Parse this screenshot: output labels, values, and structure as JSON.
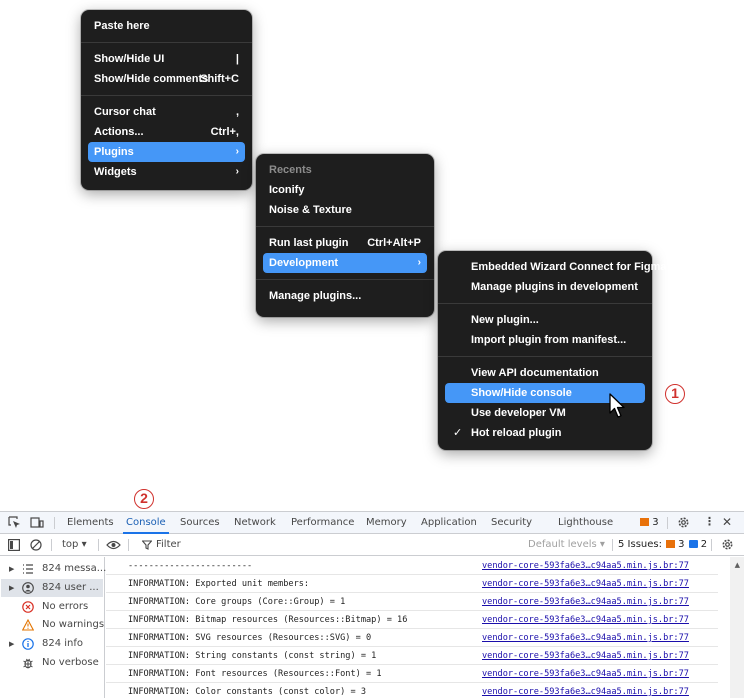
{
  "main_menu": {
    "items": [
      {
        "label": "Paste here",
        "shortcut": ""
      },
      {
        "label": "Show/Hide UI",
        "shortcut": "|"
      },
      {
        "label": "Show/Hide comments",
        "shortcut": "Shift+C"
      },
      {
        "label": "Cursor chat",
        "shortcut": ","
      },
      {
        "label": "Actions...",
        "shortcut": "Ctrl+,"
      },
      {
        "label": "Plugins",
        "chevron": "›"
      },
      {
        "label": "Widgets",
        "chevron": "›"
      }
    ]
  },
  "plugins_menu": {
    "header": "Recents",
    "items": [
      {
        "label": "Iconify"
      },
      {
        "label": "Noise & Texture"
      },
      {
        "label": "Run last plugin",
        "shortcut": "Ctrl+Alt+P"
      },
      {
        "label": "Development",
        "chevron": "›"
      },
      {
        "label": "Manage plugins..."
      }
    ]
  },
  "development_menu": {
    "items": [
      {
        "label": "Embedded Wizard Connect for Figma"
      },
      {
        "label": "Manage plugins in development"
      },
      {
        "label": "New plugin..."
      },
      {
        "label": "Import plugin from manifest..."
      },
      {
        "label": "View API documentation"
      },
      {
        "label": "Show/Hide console"
      },
      {
        "label": "Use developer VM"
      },
      {
        "label": "Hot reload plugin",
        "check": "✓"
      }
    ]
  },
  "annotations": {
    "one": "1",
    "two": "2"
  },
  "devtools": {
    "tabs": [
      "Elements",
      "Console",
      "Sources",
      "Network",
      "Performance",
      "Memory",
      "Application",
      "Security",
      "Lighthouse"
    ],
    "issues_count_tab": "3",
    "toolbar": {
      "context": "top ▾",
      "filter_placeholder": "Filter",
      "levels": "Default levels ▾",
      "issues_label": "5 Issues:",
      "issues_warn": "3",
      "issues_info": "2"
    },
    "sidebar": [
      {
        "label": "824 messa..."
      },
      {
        "label": "824 user ..."
      },
      {
        "label": "No errors"
      },
      {
        "label": "No warnings"
      },
      {
        "label": "824 info"
      },
      {
        "label": "No verbose"
      }
    ],
    "rows": [
      {
        "msg": "------------------------",
        "src": "vendor-core-593fa6e3…c94aa5.min.js.br:77"
      },
      {
        "msg": "INFORMATION: Exported unit members:",
        "src": "vendor-core-593fa6e3…c94aa5.min.js.br:77"
      },
      {
        "msg": "INFORMATION: Core groups (Core::Group) = 1",
        "src": "vendor-core-593fa6e3…c94aa5.min.js.br:77"
      },
      {
        "msg": "INFORMATION: Bitmap resources (Resources::Bitmap) = 16",
        "src": "vendor-core-593fa6e3…c94aa5.min.js.br:77"
      },
      {
        "msg": "INFORMATION: SVG resources (Resources::SVG) = 0",
        "src": "vendor-core-593fa6e3…c94aa5.min.js.br:77"
      },
      {
        "msg": "INFORMATION: String constants (const string) = 1",
        "src": "vendor-core-593fa6e3…c94aa5.min.js.br:77"
      },
      {
        "msg": "INFORMATION: Font resources (Resources::Font) = 1",
        "src": "vendor-core-593fa6e3…c94aa5.min.js.br:77"
      },
      {
        "msg": "INFORMATION: Color constants (const color) = 3",
        "src": "vendor-core-593fa6e3…c94aa5.min.js.br:77"
      }
    ]
  },
  "colors": {
    "menu_bg": "#1e1e1e",
    "menu_highlight": "#4597f7",
    "annotation": "#d0312d",
    "link": "#1a0dab"
  }
}
